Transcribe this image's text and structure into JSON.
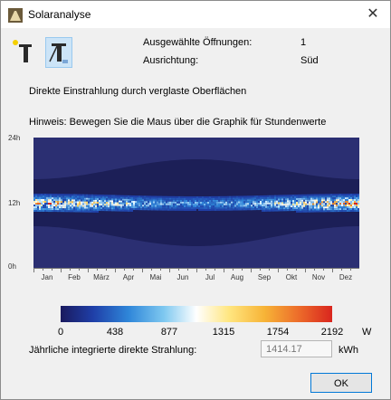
{
  "window": {
    "title": "Solaranalyse",
    "close_glyph": "✕"
  },
  "info": {
    "openings_label": "Ausgewählte Öffnungen:",
    "openings_value": "1",
    "orientation_label": "Ausrichtung:",
    "orientation_value": "Süd"
  },
  "section_title": "Direkte Einstrahlung durch verglaste Oberflächen",
  "hint": "Hinweis: Bewegen Sie die Maus über die Graphik für Stundenwerte",
  "chart_data": {
    "type": "heatmap",
    "x_labels": [
      "Jan",
      "Feb",
      "März",
      "Apr",
      "Mai",
      "Jun",
      "Jul",
      "Aug",
      "Sep",
      "Okt",
      "Nov",
      "Dez"
    ],
    "y_labels": [
      "0h",
      "12h",
      "24h"
    ],
    "ylim": [
      0,
      24
    ],
    "colorbar": {
      "ticks": [
        "0",
        "438",
        "877",
        "1315",
        "1754",
        "2192"
      ],
      "unit": "W",
      "min": 0,
      "max": 2192
    },
    "colors": {
      "background": "#2b2f72",
      "daylight_band": "#1c1f57",
      "low": "#1f3fa8",
      "mid": "#ffffff",
      "high": "#d9251e"
    }
  },
  "annual": {
    "label": "Jährliche integrierte direkte Strahlung:",
    "value": "1414.17",
    "unit": "kWh"
  },
  "buttons": {
    "ok": "OK"
  }
}
